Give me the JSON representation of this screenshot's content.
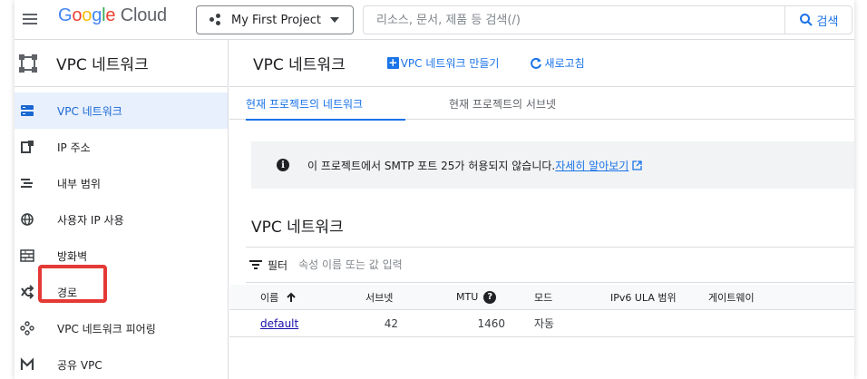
{
  "topbar": {
    "logo": {
      "g1": "G",
      "o1": "o",
      "o2": "o",
      "g2": "g",
      "l": "l",
      "e": "e",
      "cloud": " Cloud"
    },
    "project": "My First Project",
    "search_placeholder": "리소스, 문서, 제품 등 검색(/)",
    "search_button": "검색"
  },
  "sidebar": {
    "title": "VPC 네트워크",
    "items": [
      {
        "label": "VPC 네트워크",
        "icon": "vpc-network-icon",
        "active": true
      },
      {
        "label": "IP 주소",
        "icon": "ip-address-icon"
      },
      {
        "label": "내부 범위",
        "icon": "internal-range-icon"
      },
      {
        "label": "사용자 IP 사용",
        "icon": "globe-icon"
      },
      {
        "label": "방화벽",
        "icon": "firewall-icon"
      },
      {
        "label": "경로",
        "icon": "routes-icon"
      },
      {
        "label": "VPC 네트워크 피어링",
        "icon": "peering-icon"
      },
      {
        "label": "공유 VPC",
        "icon": "shared-vpc-icon"
      }
    ]
  },
  "main": {
    "title": "VPC 네트워크",
    "create_button": "VPC 네트워크 만들기",
    "refresh_button": "새로고침",
    "tabs": [
      {
        "label": "현재 프로젝트의 네트워크",
        "active": true
      },
      {
        "label": "현재 프로젝트의 서브넷"
      }
    ],
    "banner": {
      "message": "이 프로젝트에서 SMTP 포트 25가 허용되지 않습니다.",
      "link": "자세히 알아보기"
    },
    "section_title": "VPC 네트워크",
    "filter": {
      "label": "필터",
      "placeholder": "속성 이름 또는 값 입력"
    },
    "table": {
      "columns": [
        "이름",
        "서브넷",
        "MTU",
        "모드",
        "IPv6 ULA 범위",
        "게이트웨이"
      ],
      "rows": [
        {
          "name": "default",
          "subnets": "42",
          "mtu": "1460",
          "mode": "자동",
          "ipv6": "",
          "gateway": ""
        }
      ]
    }
  },
  "colors": {
    "accent": "#1a73e8",
    "highlight": "#e53935",
    "active_bg": "#e8f0fe"
  }
}
